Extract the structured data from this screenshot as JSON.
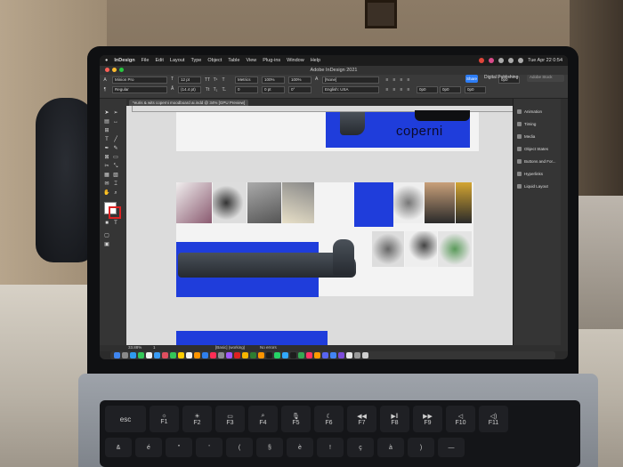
{
  "menubar": {
    "app_name": "InDesign",
    "items": [
      "File",
      "Edit",
      "Layout",
      "Type",
      "Object",
      "Table",
      "View",
      "Plug-ins",
      "Window",
      "Help"
    ],
    "datetime": "Tue Apr 22 0:54"
  },
  "window": {
    "title": "Adobe InDesign 2021",
    "share_label": "Share",
    "workspace": "Digital Publishing",
    "search_placeholder": "Adobe Stock"
  },
  "control": {
    "font_family": "Minion Pro",
    "font_style": "Regular",
    "font_size": "12 pt",
    "leading": "(14.4 pt)",
    "kerning": "Metrics",
    "tracking": "0",
    "horizontal_scale": "100%",
    "baseline": "0 pt",
    "vertical_scale": "100%",
    "skew": "0°",
    "char_style": "[None]",
    "language": "English: USA",
    "indent_1": "0p0",
    "indent_2": "0p0",
    "space_1": "0p0",
    "space_2": "0p0"
  },
  "document_tab": "*euris & wits coperni moodboard ai.indd @ 34% [GPU Preview]",
  "canvas": {
    "brand_text": "coperni"
  },
  "panels": [
    {
      "label": "Animation",
      "icon": "animation-icon"
    },
    {
      "label": "Timing",
      "icon": "timing-icon"
    },
    {
      "label": "Media",
      "icon": "media-icon"
    },
    {
      "label": "Object States",
      "icon": "object-states-icon"
    },
    {
      "label": "Buttons and For...",
      "icon": "buttons-icon"
    },
    {
      "label": "Hyperlinks",
      "icon": "hyperlinks-icon"
    },
    {
      "label": "Liquid Layout",
      "icon": "liquid-layout-icon"
    }
  ],
  "status": {
    "zoom": "33.88%",
    "page": "1",
    "style": "[Basic] (working)",
    "errors": "No errors"
  },
  "keyboard": {
    "esc": "esc",
    "fkeys": [
      "F1",
      "F2",
      "F3",
      "F4",
      "F5",
      "F6",
      "F7",
      "F8",
      "F9",
      "F10",
      "F11"
    ],
    "row2": [
      "&",
      "é",
      "\"",
      "'",
      "(",
      "§",
      "è",
      "!",
      "ç",
      "à",
      ")",
      "—"
    ]
  },
  "colors": {
    "accent_blue": "#1f3ddb",
    "share_blue": "#2d7df6"
  }
}
